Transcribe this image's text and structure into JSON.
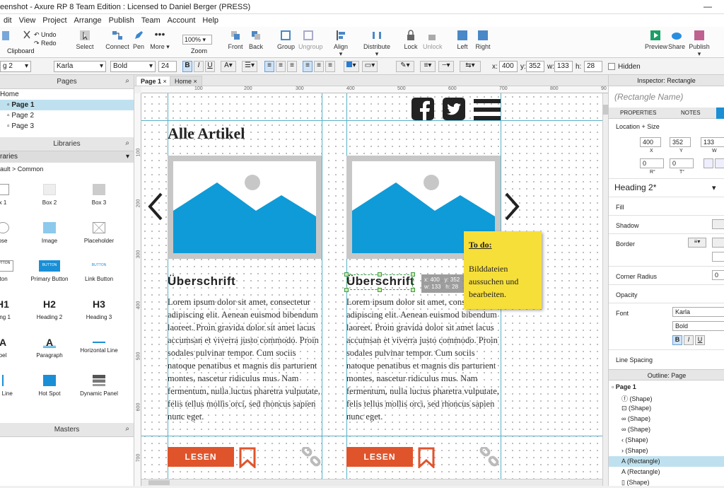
{
  "window": {
    "title": "eenshot - Axure RP 8 Team Edition : Licensed to Daniel Berger (PRESS)"
  },
  "menu": [
    "dit",
    "View",
    "Project",
    "Arrange",
    "Publish",
    "Team",
    "Account",
    "Help"
  ],
  "ribbon": {
    "undo": "Undo",
    "redo": "Redo",
    "clipboard": "Clipboard",
    "select": "Select",
    "connect": "Connect",
    "pen": "Pen",
    "more": "More ▾",
    "zoom_value": "100%",
    "zoom": "Zoom",
    "front": "Front",
    "back": "Back",
    "group": "Group",
    "ungroup": "Ungroup",
    "align": "Align ▾",
    "distribute": "Distribute ▾",
    "lock": "Lock",
    "unlock": "Unlock",
    "left": "Left",
    "right": "Right",
    "preview": "Preview",
    "share": "Share",
    "publish": "Publish ▾"
  },
  "format": {
    "style": "g 2",
    "font": "Karla",
    "weight": "Bold",
    "size": "24",
    "x_label": "x:",
    "x": "400",
    "y_label": "y:",
    "y": "352",
    "w_label": "w:",
    "w": "133",
    "h_label": "h:",
    "h": "28",
    "hidden": "Hidden"
  },
  "pages": {
    "title": "Pages",
    "home": "Home",
    "items": [
      "Page 1",
      "Page 2",
      "Page 3"
    ]
  },
  "libraries": {
    "title": "Libraries",
    "dropdown": "raries",
    "path": "ault > Common",
    "items": [
      "x 1",
      "Box 2",
      "Box 3",
      "pse",
      "Image",
      "Placeholder",
      "tton",
      "Primary Button",
      "Link Button",
      "ding 1",
      "Heading 2",
      "Heading 3",
      "bel",
      "Paragraph",
      "Horizontal Line",
      "cal Line",
      "Hot Spot",
      "Dynamic Panel"
    ],
    "glyphs": {
      "h1": "H1",
      "h2": "H2",
      "h3": "H3",
      "btn": "BUTTON"
    }
  },
  "masters": {
    "title": "Masters"
  },
  "canvas_tabs": [
    "Page 1",
    "Home"
  ],
  "ruler_h": [
    "100",
    "200",
    "300",
    "400",
    "500",
    "600",
    "700",
    "800",
    "90"
  ],
  "ruler_v": [
    "100",
    "200",
    "300",
    "400",
    "500",
    "600",
    "700"
  ],
  "design": {
    "page_heading": "Alle Artikel",
    "heading": "Überschrift",
    "paragraph": "Lorem ipsum dolor sit amet, consectetur adipiscing elit. Aenean euismod bibendum laoreet. Proin gravida dolor sit amet lacus accumsan et viverra justo commodo. Proin sodales pulvinar tempor. Cum sociis natoque penatibus et magnis dis parturient montes, nascetur ridiculus mus. Nam fermentum, nulla luctus pharetra vulputate, felis tellus mollis orci, sed rhoncus sapien nunc eget.",
    "button": "LESEN",
    "selection_info": "x: 400   y: 352\nw: 133   h: 28",
    "sticky_title": "To do:",
    "sticky_body": "Bilddateien aussuchen und bearbeiten."
  },
  "inspector": {
    "title": "Inspector: Rectangle",
    "name_placeholder": "(Rectangle Name)",
    "tab_properties": "PROPERTIES",
    "tab_notes": "NOTES",
    "location_size": "Location + Size",
    "x": "400",
    "y": "352",
    "w": "133",
    "r": "0",
    "t": "0",
    "x_lbl": "X",
    "y_lbl": "Y",
    "w_lbl": "W",
    "r_lbl": "R°",
    "t_lbl": "T°",
    "style": "Heading 2*",
    "fill": "Fill",
    "shadow": "Shadow",
    "border": "Border",
    "corner_radius": "Corner Radius",
    "corner_value": "0",
    "opacity": "Opacity",
    "font": "Font",
    "font_value": "Karla",
    "weight_value": "Bold",
    "line_spacing": "Line Spacing"
  },
  "outline": {
    "title": "Outline: Page",
    "root": "Page 1",
    "items": [
      "(Shape)",
      "(Shape)",
      "(Shape)",
      "(Shape)",
      "(Shape)",
      "(Shape)",
      "(Rectangle)",
      "(Rectangle)",
      "(Shape)"
    ]
  },
  "colors": {
    "accent": "#e0542b",
    "sky": "#0f9bd7",
    "guide": "#5ab0c8",
    "sticky": "#f7df3a"
  }
}
